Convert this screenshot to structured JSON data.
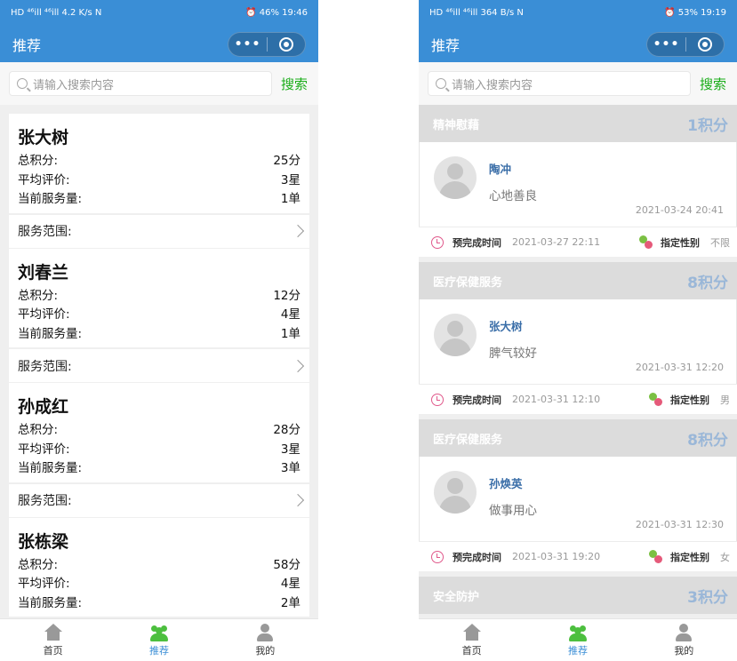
{
  "left": {
    "status": {
      "left": "HD ⁴⁶ill ⁴⁶ill 4.2 K/s N",
      "right": "⏰ 46% 19:46"
    },
    "nav_title": "推荐",
    "search_placeholder": "请输入搜索内容",
    "search_button": "搜索",
    "labels": {
      "points": "总积分:",
      "rating": "平均评价:",
      "current": "当前服务量:",
      "scope": "服务范围:"
    },
    "providers": [
      {
        "name": "张大树",
        "points": "25分",
        "rating": "3星",
        "current": "1单"
      },
      {
        "name": "刘春兰",
        "points": "12分",
        "rating": "4星",
        "current": "1单"
      },
      {
        "name": "孙成红",
        "points": "28分",
        "rating": "3星",
        "current": "3单"
      },
      {
        "name": "张栋梁",
        "points": "58分",
        "rating": "4星",
        "current": "2单"
      }
    ],
    "tabs": [
      {
        "label": "首页"
      },
      {
        "label": "推荐"
      },
      {
        "label": "我的"
      }
    ]
  },
  "right": {
    "status": {
      "left": "HD ⁴⁶ill ⁴⁶ill 364 B/s N",
      "right": "⏰ 53% 19:19"
    },
    "nav_title": "推荐",
    "search_placeholder": "请输入搜索内容",
    "search_button": "搜索",
    "foot_labels": {
      "deadline": "预完成时间",
      "gender": "指定性别"
    },
    "orders": [
      {
        "category": "精神慰藉",
        "points": "1积分",
        "name": "陶冲",
        "desc": "心地善良",
        "time": "2021-03-24 20:41",
        "deadline": "2021-03-27 22:11",
        "gender": "不限"
      },
      {
        "category": "医疗保健服务",
        "points": "8积分",
        "name": "张大树",
        "desc": "脾气较好",
        "time": "2021-03-31 12:20",
        "deadline": "2021-03-31 12:10",
        "gender": "男"
      },
      {
        "category": "医疗保健服务",
        "points": "8积分",
        "name": "孙焕英",
        "desc": "做事用心",
        "time": "2021-03-31 12:30",
        "deadline": "2021-03-31 19:20",
        "gender": "女"
      },
      {
        "category": "安全防护",
        "points": "3积分"
      }
    ],
    "tabs": [
      {
        "label": "首页"
      },
      {
        "label": "推荐"
      },
      {
        "label": "我的"
      }
    ]
  },
  "colors": {
    "primary": "#3a8ed6",
    "search_green": "#1aad19",
    "points_blue": "#9ab7d8"
  },
  "icons": [
    "search-icon",
    "more-icon",
    "close-target-icon",
    "chevron-right-icon",
    "avatar-icon",
    "alarm-clock-icon",
    "gender-icon",
    "home-icon",
    "group-icon",
    "user-icon"
  ]
}
